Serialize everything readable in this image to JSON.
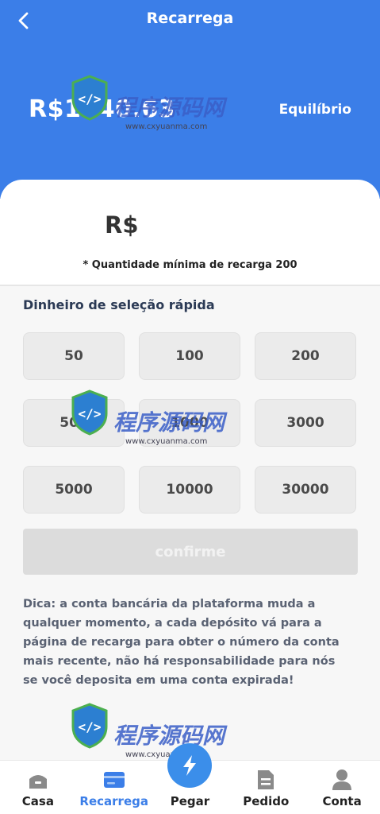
{
  "header": {
    "title": "Recarrega",
    "balance": "R$1340.63",
    "balance_label": "Equilíbrio"
  },
  "recharge": {
    "currency": "R$",
    "min_note": "* Quantidade mínima de recarga 200"
  },
  "quick": {
    "title": "Dinheiro de seleção rápida",
    "amounts": [
      "50",
      "100",
      "200",
      "500",
      "1000",
      "3000",
      "5000",
      "10000",
      "30000"
    ]
  },
  "confirm_label": "confirme",
  "tip": "Dica: a conta bancária da plataforma muda a qualquer momento, a cada depósito vá para a página de recarga para obter o número da conta mais recente, não há responsabilidade para nós se você deposita em uma conta expirada!",
  "tabbar": {
    "items": [
      {
        "label": "Casa",
        "icon": "home-icon"
      },
      {
        "label": "Recarrega",
        "icon": "card-icon"
      },
      {
        "label": "Pegar",
        "icon": "lightning-icon"
      },
      {
        "label": "Pedido",
        "icon": "document-icon"
      },
      {
        "label": "Conta",
        "icon": "user-icon"
      }
    ]
  },
  "watermark": {
    "text": "程序源码网",
    "sub": "www.cxyuanma.com"
  },
  "colors": {
    "accent": "#3b7ee8",
    "button_disabled": "#dcdcdc"
  }
}
